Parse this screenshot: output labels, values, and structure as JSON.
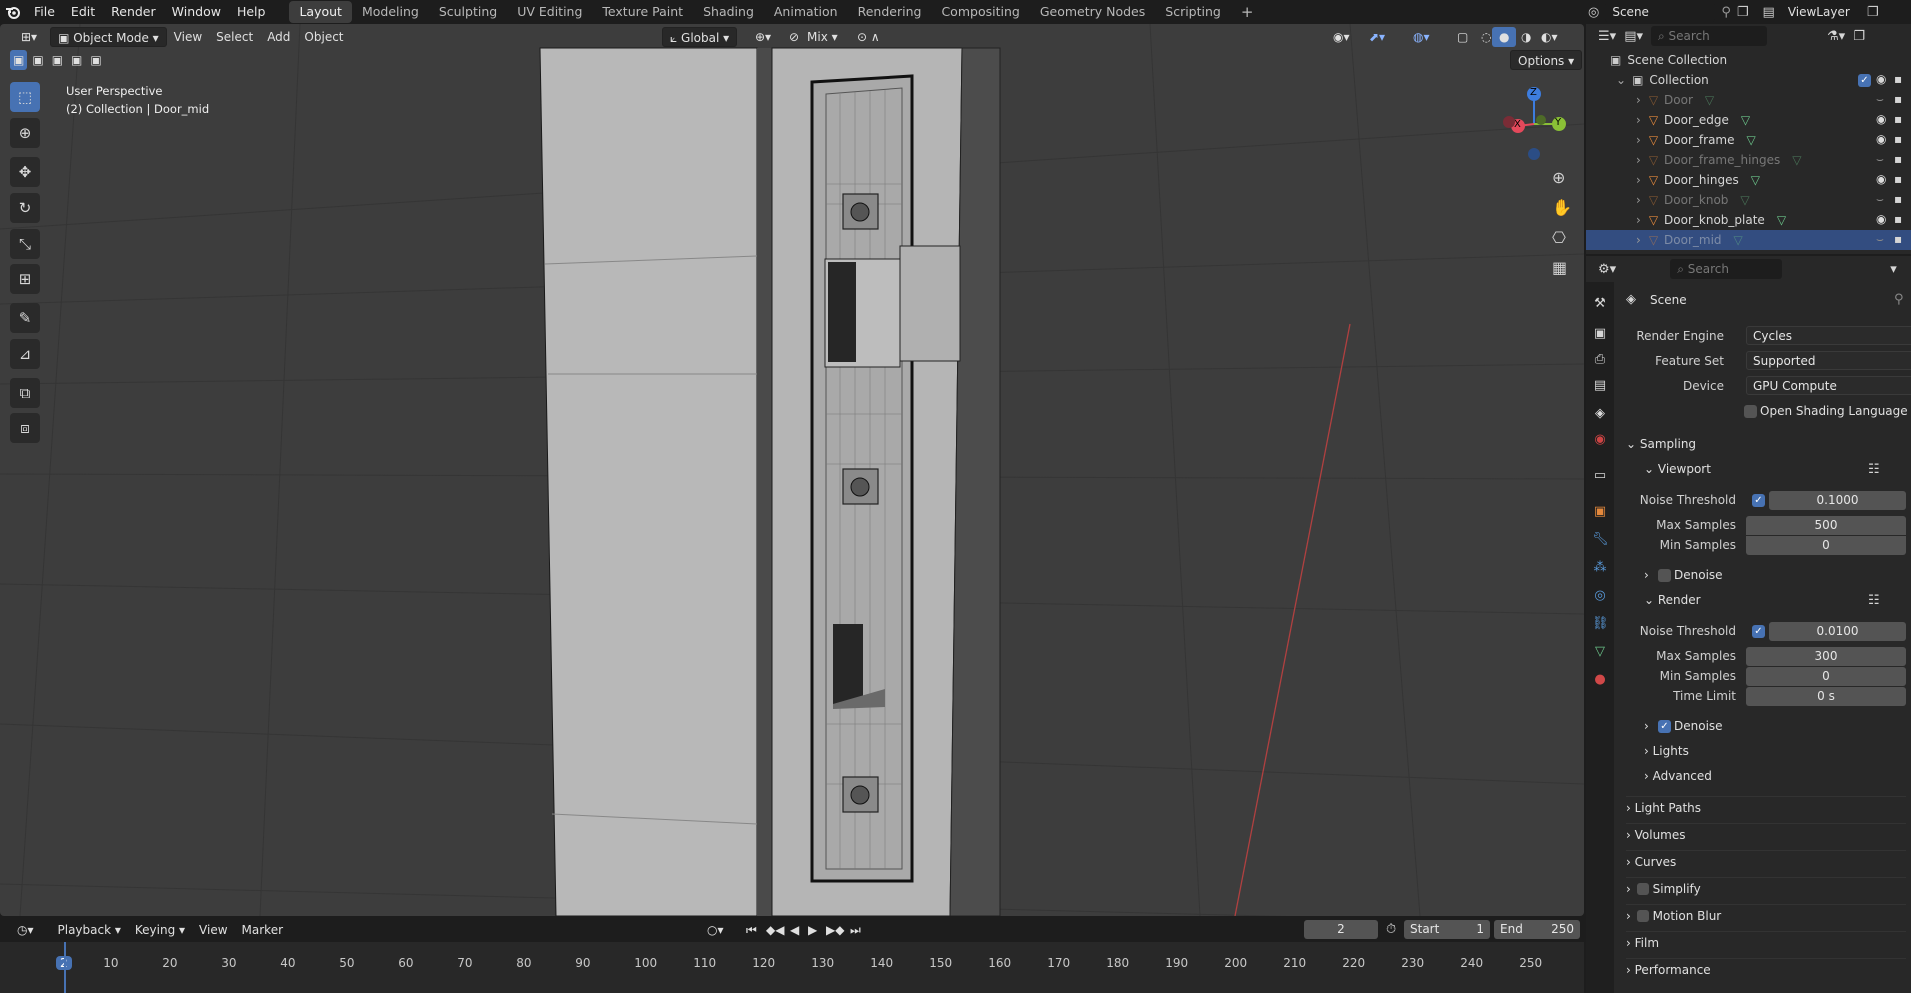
{
  "menu": [
    "File",
    "Edit",
    "Render",
    "Window",
    "Help"
  ],
  "workspaces": [
    {
      "label": "Layout",
      "active": true
    },
    {
      "label": "Modeling"
    },
    {
      "label": "Sculpting"
    },
    {
      "label": "UV Editing"
    },
    {
      "label": "Texture Paint"
    },
    {
      "label": "Shading"
    },
    {
      "label": "Animation"
    },
    {
      "label": "Rendering"
    },
    {
      "label": "Compositing"
    },
    {
      "label": "Geometry Nodes"
    },
    {
      "label": "Scripting"
    }
  ],
  "plus_tab": "+",
  "scene_name": "Scene",
  "view_layer": "ViewLayer",
  "viewport": {
    "mode": "Object Mode",
    "menus": [
      "View",
      "Select",
      "Add",
      "Object"
    ],
    "transform_orientation": "Global",
    "snap_mix": "Mix",
    "options": "Options",
    "perspective": "User Perspective",
    "collection_info": "(2) Collection | Door_mid"
  },
  "gizmo": {
    "x": "X",
    "y": "Y",
    "z": "Z"
  },
  "outliner": {
    "search_placeholder": "Search",
    "scene_collection": "Scene Collection",
    "collection": "Collection",
    "items": [
      {
        "name": "Door",
        "hidden": true
      },
      {
        "name": "Door_edge",
        "hidden": false
      },
      {
        "name": "Door_frame",
        "hidden": false
      },
      {
        "name": "Door_frame_hinges",
        "hidden": true
      },
      {
        "name": "Door_hinges",
        "hidden": false
      },
      {
        "name": "Door_knob",
        "hidden": true
      },
      {
        "name": "Door_knob_plate",
        "hidden": false
      },
      {
        "name": "Door_mid",
        "hidden": true,
        "selected": true
      }
    ]
  },
  "properties": {
    "search_placeholder": "Search",
    "context": "Scene",
    "render_engine_label": "Render Engine",
    "render_engine": "Cycles",
    "feature_set_label": "Feature Set",
    "feature_set": "Supported",
    "device_label": "Device",
    "device": "GPU Compute",
    "osl": "Open Shading Language",
    "sampling": "Sampling",
    "viewport": "Viewport",
    "noise_threshold_label": "Noise Threshold",
    "vp_noise": "0.1000",
    "max_samples_label": "Max Samples",
    "vp_max": "500",
    "min_samples_label": "Min Samples",
    "vp_min": "0",
    "denoise": "Denoise",
    "render": "Render",
    "r_noise": "0.0100",
    "r_max": "300",
    "r_min": "0",
    "time_limit_label": "Time Limit",
    "time_limit": "0 s",
    "render_denoise": "Denoise",
    "lights": "Lights",
    "advanced": "Advanced",
    "panels": [
      "Light Paths",
      "Volumes",
      "Curves",
      "Simplify",
      "Motion Blur",
      "Film",
      "Performance"
    ]
  },
  "timeline": {
    "menus": [
      "Playback",
      "Keying",
      "View",
      "Marker"
    ],
    "current_frame": "2",
    "start_label": "Start",
    "start": "1",
    "end_label": "End",
    "end": "250",
    "ticks": [
      "2",
      "10",
      "20",
      "30",
      "40",
      "50",
      "60",
      "70",
      "80",
      "90",
      "100",
      "110",
      "120",
      "130",
      "140",
      "150",
      "160",
      "170",
      "180",
      "190",
      "200",
      "210",
      "220",
      "230",
      "240",
      "250"
    ]
  },
  "colors": {
    "accent": "#4772b3",
    "selected_row": "#334d80",
    "viewport_bg": "#3d3d3d",
    "object_orange": "#e3883c",
    "mesh_green": "#6bc48a",
    "x_axis": "#e4495b",
    "y_axis": "#8ac036",
    "z_axis": "#3d7ddf"
  }
}
